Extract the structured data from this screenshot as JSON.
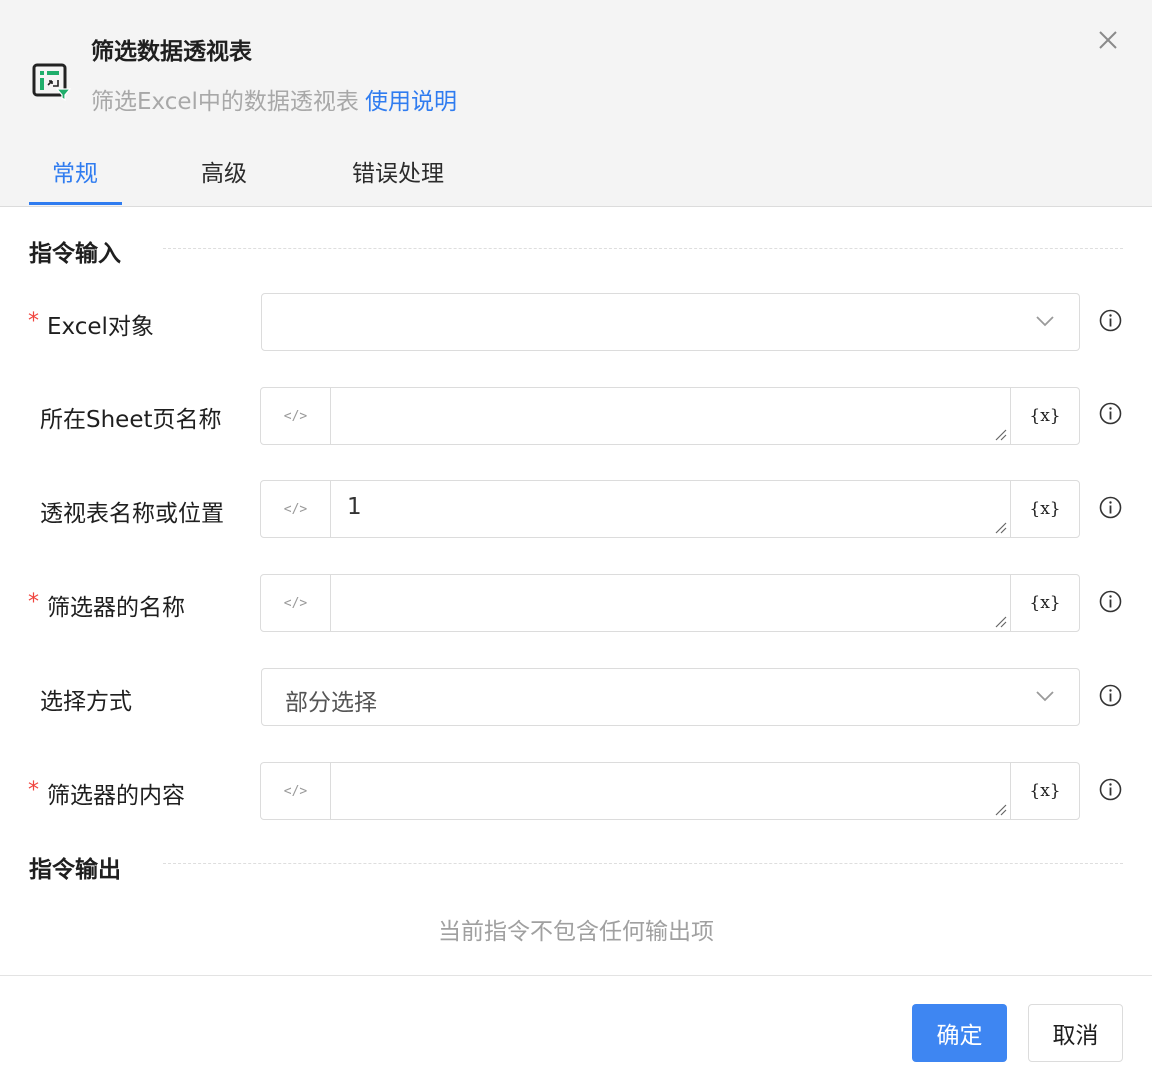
{
  "header": {
    "title": "筛选数据透视表",
    "subtitle": "筛选Excel中的数据透视表",
    "help_link": "使用说明",
    "icon": "pivot-table-filter-icon"
  },
  "tabs": [
    {
      "label": "常规",
      "active": true
    },
    {
      "label": "高级",
      "active": false
    },
    {
      "label": "错误处理",
      "active": false
    }
  ],
  "sections": {
    "input_title": "指令输入",
    "output_title": "指令输出",
    "no_output_text": "当前指令不包含任何输出项"
  },
  "fields": {
    "excel_object": {
      "label": "Excel对象",
      "required": true,
      "value": ""
    },
    "sheet_name": {
      "label": "所在Sheet页名称",
      "required": false,
      "value": ""
    },
    "pivot_name": {
      "label": "透视表名称或位置",
      "required": false,
      "value": "1"
    },
    "filter_name": {
      "label": "筛选器的名称",
      "required": true,
      "value": ""
    },
    "select_mode": {
      "label": "选择方式",
      "required": false,
      "value": "部分选择"
    },
    "filter_content": {
      "label": "筛选器的内容",
      "required": true,
      "value": ""
    }
  },
  "controls": {
    "required_mark": "*",
    "code_toggle": "</>",
    "variable_button": "{x}"
  },
  "footer": {
    "ok_label": "确定",
    "cancel_label": "取消"
  },
  "colors": {
    "accent": "#2f7cf0",
    "required": "#f0453f",
    "primary_button": "#3e86f2"
  }
}
